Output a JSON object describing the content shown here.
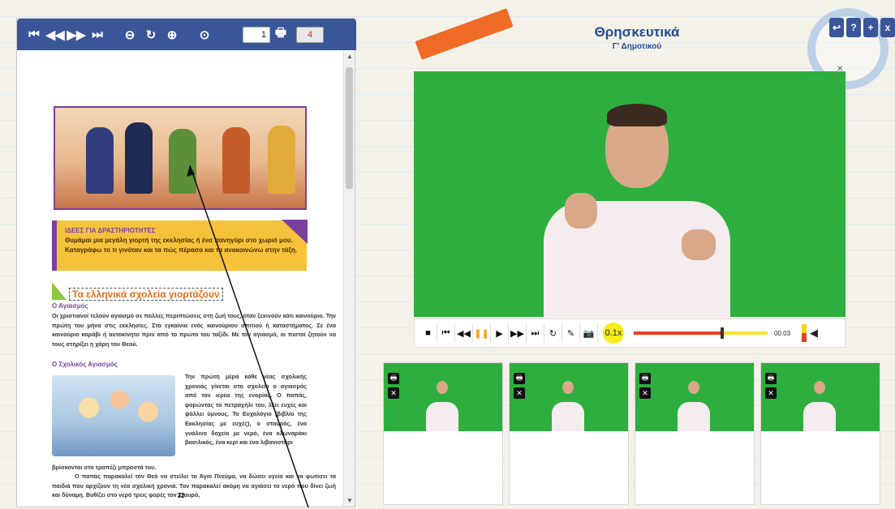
{
  "toolbar": {
    "buttons": [
      "first-page",
      "prev-page",
      "next-page",
      "last-page",
      "zoom-out",
      "rotate",
      "zoom-in",
      "play"
    ],
    "page_current": "1",
    "page_total": "4"
  },
  "document": {
    "idea_title": "ΙΔΕΕΣ ΓΙΑ ΔΡΑΣΤΗΡΙΟΤΗΤΕΣ",
    "idea_text": "Θυμάμαι μια μεγάλη γιορτή της εκκλησίας ή ένα πανηγύρι στο χωριό μου. Καταγράφω το τι γινόταν και τα πώς πέρασα και τα ανακοινώνω στην τάξη.",
    "section_title": "Τα ελληνικά σχολεία γιορτάζουν",
    "sub1": "Ο Αγιασμός",
    "para1": "Οι χριστιανοί τελούν αγιασμό σε πολλές περιπτώσεις στη ζωή τους, όταν ξεκινούν κάτι καινούριο. Την πρώτη του μήνα στις εκκλησίες. Στα εγκαίνια ενός καινούριου σπιτιού ή καταστήματος. Σε ένα καινούριο καράβι ή αυτοκίνητο πριν από το πρώτο του ταξίδι. Με τον αγιασμό, οι πιστοί ζητούν να τους στηρίξει η χάρη του Θεού.",
    "sub2": "Ο Σχολικός Αγιασμός",
    "para2": "Την πρώτη μέρα κάθε νέας σχολικής χρονιάς γίνεται στο σχολείο ο αγιασμός από τον ιερέα της ενορίας. Ο παπάς, φορώντας το πετραχήλι του, λέει ευχές και ψάλλει ύμνους. Το Ευχολόγιο (βιβλίο της Εκκλησίας με ευχές), ο σταυρός, ένα γυάλινο δοχείο με νερό, ένα κλωναράκι βασιλικός, ένα κερί και ένα λιβανιστήρι",
    "para3": "βρίσκονται στο τραπέζι μπροστά του.",
    "para4": "Ο παπάς παρακαλεί τον Θεό να στείλει το Άγιο Πνεύμα, να δώσει υγεία και να φωτίσει τα παιδιά που αρχίζουν τη νέα σχολική χρονιά. Τον παρακαλεί ακόμη να αγιάσει το νερό που δίνει ζωή και δύναμη. Βυθίζει στο νερό τρεις φορές τον Σταυρό,",
    "page_number": "32"
  },
  "header": {
    "title": "Θρησκευτικά",
    "subtitle": "Γ' Δημοτικού",
    "corner_buttons": [
      "back",
      "?",
      "+",
      "x"
    ]
  },
  "player": {
    "speed": "0.1x",
    "time": "00.03",
    "progress_fraction": 0.66,
    "controls": [
      "stop",
      "skip-back",
      "rewind",
      "pause",
      "play",
      "fast-forward",
      "skip-forward",
      "replay",
      "edit",
      "snapshot"
    ]
  },
  "thumbnails": [
    {
      "print": "print",
      "close": "x"
    },
    {
      "print": "print",
      "close": "x"
    },
    {
      "print": "print",
      "close": "x"
    },
    {
      "print": "print",
      "close": "x"
    }
  ],
  "colors": {
    "toolbar_blue": "#3a5598",
    "title_blue": "#1f4b99",
    "video_green": "#2eae3f",
    "accent_orange": "#e36c1e",
    "accent_purple": "#7b3fa0"
  }
}
